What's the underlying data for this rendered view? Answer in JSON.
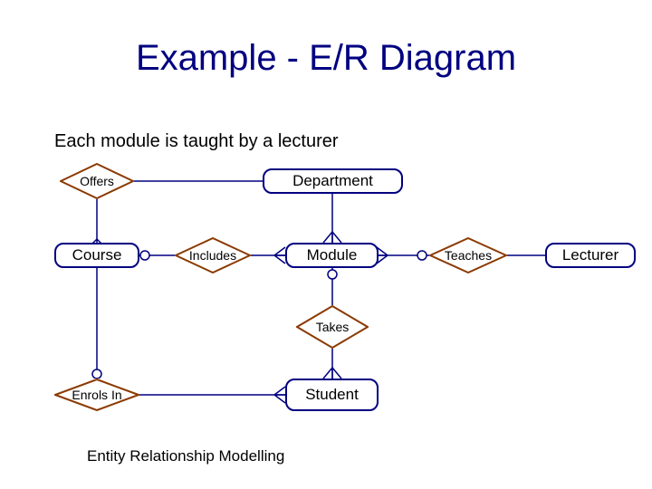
{
  "title": "Example - E/R Diagram",
  "subtitle": "Each module is taught by a lecturer",
  "footer": "Entity Relationship Modelling",
  "entities": {
    "department": "Department",
    "course": "Course",
    "module": "Module",
    "lecturer": "Lecturer",
    "student": "Student"
  },
  "relationships": {
    "offers": "Offers",
    "includes": "Includes",
    "teaches": "Teaches",
    "takes": "Takes",
    "enrols_in": "Enrols In"
  }
}
